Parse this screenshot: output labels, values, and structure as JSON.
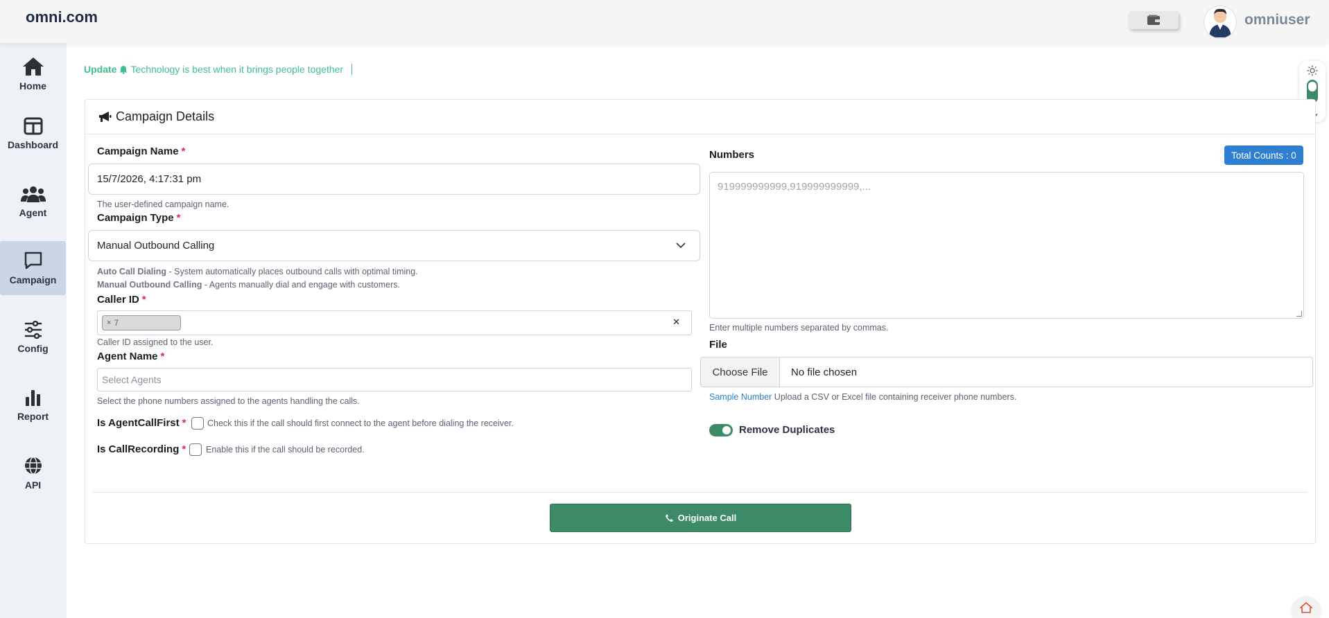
{
  "header": {
    "brand": "omni.com",
    "username": "omniuser"
  },
  "sidebar": {
    "items": [
      {
        "label": "Home",
        "icon": "home-icon",
        "active": false
      },
      {
        "label": "Dashboard",
        "icon": "dashboard-icon",
        "active": false
      },
      {
        "label": "Agent",
        "icon": "users-icon",
        "active": false
      },
      {
        "label": "Campaign",
        "icon": "chat-icon",
        "active": true
      },
      {
        "label": "Config",
        "icon": "sliders-icon",
        "active": false
      },
      {
        "label": "Report",
        "icon": "bar-chart-icon",
        "active": false
      },
      {
        "label": "API",
        "icon": "globe-icon",
        "active": false
      }
    ]
  },
  "ticker": {
    "prefix": "Update",
    "message": "Technology is best when it brings people together"
  },
  "card": {
    "title": "Campaign Details"
  },
  "form": {
    "campaign_name": {
      "label": "Campaign Name",
      "value": "15/7/2026, 4:17:31 pm",
      "help": "The user-defined campaign name."
    },
    "campaign_type": {
      "label": "Campaign Type",
      "value": "Manual Outbound Calling",
      "help_auto_title": "Auto Call Dialing",
      "help_auto_text": " - System automatically places outbound calls with optimal timing.",
      "help_manual_title": "Manual Outbound Calling",
      "help_manual_text": " - Agents manually dial and engage with customers."
    },
    "caller_id": {
      "label": "Caller ID",
      "chip_value": "7",
      "help": "Caller ID assigned to the user."
    },
    "agent_name": {
      "label": "Agent Name",
      "placeholder": "Select Agents",
      "help": "Select the phone numbers assigned to the agents handling the calls."
    },
    "agent_call_first": {
      "label": "Is AgentCallFirst",
      "help": "Check this if the call should first connect to the agent before dialing the receiver.",
      "checked": false
    },
    "call_recording": {
      "label": "Is CallRecording",
      "help": "Enable this if the call should be recorded.",
      "checked": false
    },
    "numbers": {
      "label": "Numbers",
      "total_counts": "Total Counts : 0",
      "placeholder": "919999999999,919999999999,...",
      "help": "Enter multiple numbers separated by commas."
    },
    "file": {
      "label": "File",
      "button": "Choose File",
      "status": "No file chosen",
      "sample_link": "Sample Number",
      "help": " Upload a CSV or Excel file containing receiver phone numbers."
    },
    "remove_duplicates": {
      "label": "Remove Duplicates",
      "on": true
    },
    "submit": "Originate Call"
  },
  "colors": {
    "primary_green": "#3c8a68",
    "accent_blue": "#2f7fd1",
    "ticker_green": "#3fbf8a",
    "required_red": "#e0245e"
  }
}
